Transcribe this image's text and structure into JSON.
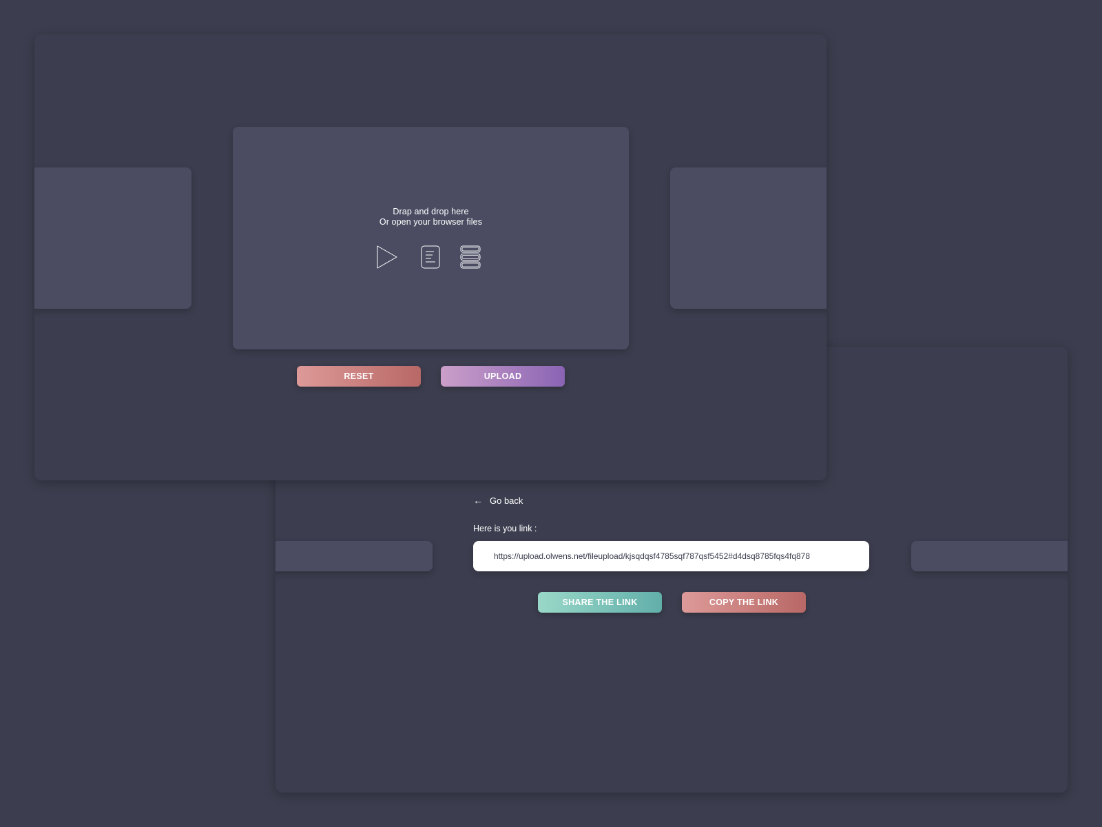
{
  "upload_view": {
    "drop_line_1": "Drap and drop here",
    "drop_line_2": "Or open your browser files",
    "icons": [
      "play-icon",
      "document-icon",
      "stack-icon"
    ],
    "reset_label": "RESET",
    "upload_label": "UPLOAD"
  },
  "link_view": {
    "go_back_arrow": "←",
    "go_back_label": "Go back",
    "link_label": "Here is you link :",
    "link_value": "https://upload.olwens.net/fileupload/kjsqdqsf4785sqf787qsf5452#d4dsq8785fqs4fq878",
    "share_label": "SHARE THE LINK",
    "copy_label": "COPY THE LINK"
  },
  "colors": {
    "background": "#3c3e4f",
    "panel": "#4b4c62",
    "reset_gradient": [
      "#dd9a98",
      "#b86866"
    ],
    "upload_gradient": [
      "#cb9fc9",
      "#8a64b4"
    ],
    "share_gradient": [
      "#99d8c8",
      "#62afaa"
    ],
    "copy_gradient": [
      "#dd9a98",
      "#b86866"
    ]
  }
}
